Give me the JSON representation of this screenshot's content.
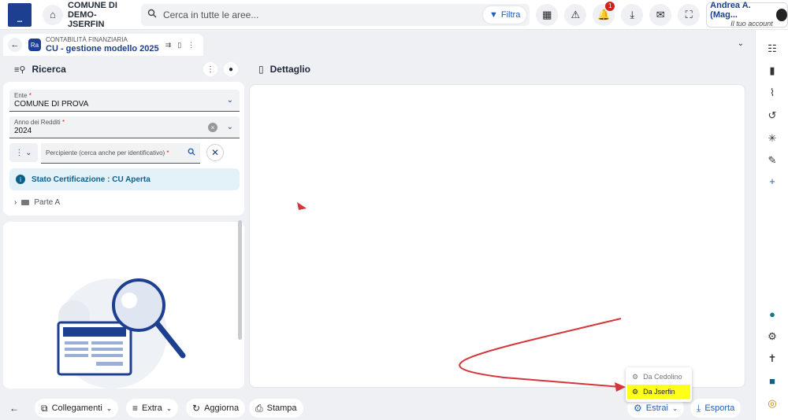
{
  "topbar": {
    "logo_icon": "municipality-logo",
    "comune_line1": "COMUNE DI",
    "comune_line2": "DEMO-JSERFIN",
    "search_placeholder": "Cerca in tutte le aree...",
    "filter_label": "Filtra",
    "notification_count": "1",
    "user_name": "Andrea A. (Mag...",
    "user_sub": "Il tuo account"
  },
  "tab": {
    "category": "CONTABILITÀ FINANZIARIA",
    "title": "CU - gestione modello 2025",
    "app_badge": "Ra"
  },
  "left": {
    "title": "Ricerca",
    "ente_label": "Ente",
    "ente_value": "COMUNE DI PROVA",
    "anno_label": "Anno dei Redditi",
    "anno_value": "2024",
    "percipiente_placeholder": "Percipiente (cerca anche per identificativo)",
    "required_mark": "*",
    "stato_text": "Stato Certificazione : CU Aperta",
    "tree_item": "Parte A"
  },
  "detail": {
    "title": "Dettaglio"
  },
  "bottombar": {
    "collegamenti": "Collegamenti",
    "extra": "Extra",
    "aggiorna": "Aggiorna",
    "stampa": "Stampa",
    "estrai": "Estrai",
    "esporta": "Esporta"
  },
  "popup": {
    "item1": "Da Cedolino",
    "item2": "Da Jserfin"
  },
  "colors": {
    "brand": "#1c3f8f",
    "highlight": "#ffff19",
    "annotation_arrow": "#d6363a"
  }
}
